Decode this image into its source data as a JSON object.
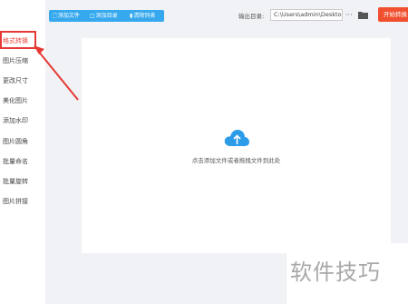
{
  "sidebar": {
    "items": [
      {
        "label": "格式转换",
        "active": true
      },
      {
        "label": "图片压缩",
        "active": false
      },
      {
        "label": "更改尺寸",
        "active": false
      },
      {
        "label": "美化图片",
        "active": false
      },
      {
        "label": "添加水印",
        "active": false
      },
      {
        "label": "图片圆角",
        "active": false
      },
      {
        "label": "批量命名",
        "active": false
      },
      {
        "label": "批量旋转",
        "active": false
      },
      {
        "label": "图片拼接",
        "active": false
      }
    ]
  },
  "toolbar": {
    "add_file": "添加文件",
    "add_folder": "添加目录",
    "clear_list": "清除列表"
  },
  "output": {
    "label": "输出目录:",
    "path": "C:\\Users\\admin\\Deskto",
    "more": "···"
  },
  "start_button": "开始转换",
  "dropzone": {
    "hint": "点击添加文件或者拖拽文件到此处"
  },
  "watermark": "软件技巧",
  "colors": {
    "accent_blue": "#36a9ee",
    "start_orange": "#f0502f",
    "highlight_red": "#e53935"
  }
}
